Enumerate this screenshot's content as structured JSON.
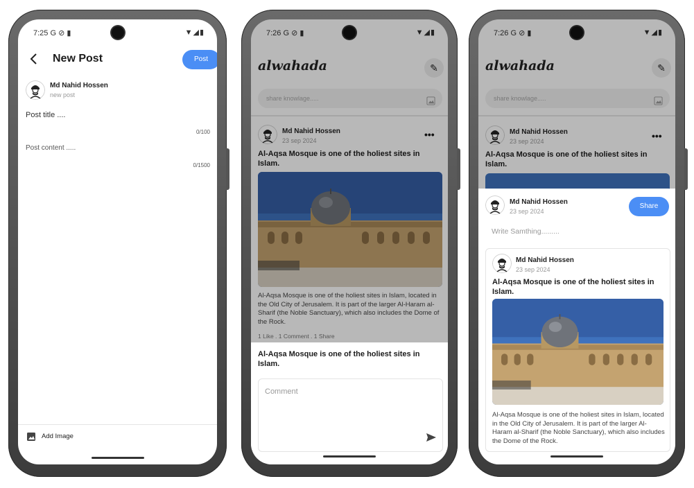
{
  "phone1": {
    "status": {
      "time": "7:25",
      "icons": "G ⊘ ▮",
      "right_icons": "▼◢▮"
    },
    "header": {
      "back_icon": "arrow-left-icon",
      "title": "New Post",
      "post_button": "Post"
    },
    "author": {
      "name": "Md Nahid Hossen",
      "sub": "new post"
    },
    "title_field": {
      "placeholder": "Post title ....",
      "counter": "0/100"
    },
    "content_field": {
      "placeholder": "Post content .....",
      "counter": "0/1500"
    },
    "footer": {
      "add_image_label": "Add Image",
      "image_icon": "image-icon"
    }
  },
  "phone2": {
    "status": {
      "time": "7:26",
      "icons": "G ⊘ ▮",
      "right_icons": "▼◢▮"
    },
    "app_bar": {
      "logo": "alwahada",
      "edit_icon": "pencil-icon"
    },
    "search": {
      "placeholder": "share knowlage.....",
      "image_icon": "image-icon"
    },
    "post": {
      "author": "Md Nahid Hossen",
      "date": "23 sep 2024",
      "menu_icon": "more-horizontal-icon",
      "title": "Al-Aqsa Mosque is one of the holiest sites in Islam.",
      "body": "Al-Aqsa Mosque is one of the holiest sites in Islam, located in the Old City of Jerusalem. It is part of the larger Al-Haram al-Sharif (the Noble Sanctuary), which also includes the Dome of the Rock.",
      "stats": "1 Like . 1 Comment . 1 Share"
    },
    "sheet": {
      "title": "Al-Aqsa Mosque is one of the holiest sites in Islam.",
      "comment_placeholder": "Comment",
      "send_icon": "send-icon"
    }
  },
  "phone3": {
    "status": {
      "time": "7:26",
      "icons": "G ⊘ ▮",
      "right_icons": "▼◢▮"
    },
    "app_bar": {
      "logo": "alwahada",
      "edit_icon": "pencil-icon"
    },
    "search": {
      "placeholder": "share knowlage.....",
      "image_icon": "image-icon"
    },
    "post": {
      "author": "Md Nahid Hossen",
      "date": "23 sep 2024",
      "menu_icon": "more-horizontal-icon",
      "title": "Al-Aqsa Mosque is one of the holiest sites in Islam."
    },
    "share_sheet": {
      "author": "Md Nahid Hossen",
      "date": "23 sep 2024",
      "share_button": "Share",
      "write_placeholder": "Write Samthing.........",
      "card": {
        "author": "Md Nahid Hossen",
        "date": "23 sep 2024",
        "title": "Al-Aqsa Mosque is one of the holiest sites in Islam.",
        "body": "Al-Aqsa Mosque is one of the holiest sites in Islam, located in the Old City of Jerusalem. It is part of the larger Al-Haram al-Sharif (the Noble Sanctuary), which also includes the Dome of the Rock."
      }
    }
  },
  "colors": {
    "accent": "#4b8ef5",
    "sky": "#3d6fb8",
    "stone": "#c9a977"
  }
}
